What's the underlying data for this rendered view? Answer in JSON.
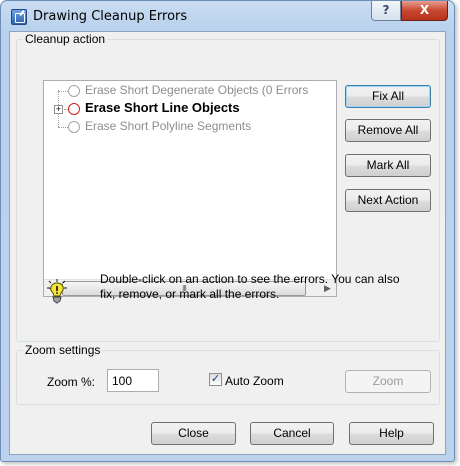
{
  "window": {
    "title": "Drawing Cleanup Errors",
    "help_button": "?",
    "close_button": "X"
  },
  "cleanup": {
    "legend": "Cleanup action",
    "items": [
      {
        "label": "Erase Short Degenerate Objects (0 Errors"
      },
      {
        "label": "Erase Short Line Objects",
        "expander": "+"
      },
      {
        "label": "Erase Short Polyline Segments"
      }
    ],
    "scroll": {
      "left": "◀",
      "right": "▶",
      "thumb": "III"
    },
    "buttons": {
      "fix_all": "Fix All",
      "remove_all": "Remove All",
      "mark_all": "Mark All",
      "next_action": "Next Action"
    },
    "hint": "Double-click on an action to see the errors. You can also fix, remove, or mark all the errors."
  },
  "zoom": {
    "legend": "Zoom settings",
    "zoom_label": "Zoom %:",
    "zoom_value": "100",
    "auto_zoom_label": "Auto Zoom",
    "auto_zoom_checked": true,
    "check_mark": "✓",
    "zoom_button": "Zoom"
  },
  "footer": {
    "close": "Close",
    "cancel": "Cancel",
    "help": "Help"
  },
  "colors": {
    "title_bg": "#c4daf3",
    "close_red": "#c8472f",
    "radio_red": "#d21d1d",
    "hint_yellow": "#f5e33a"
  }
}
